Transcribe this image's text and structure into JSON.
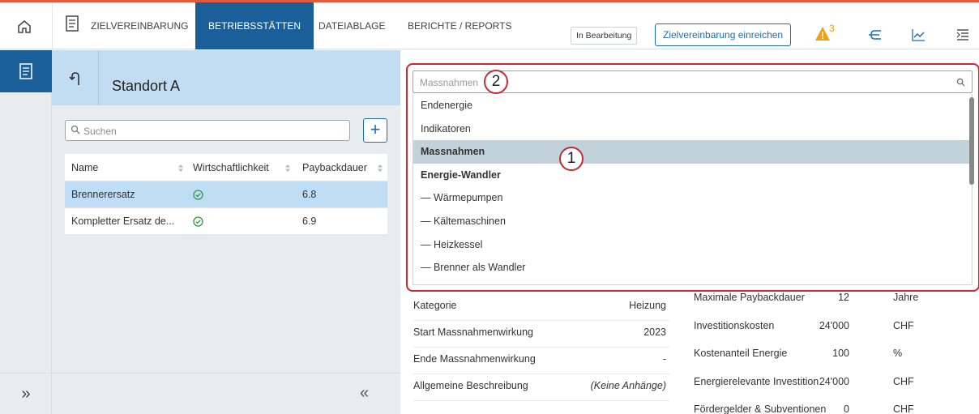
{
  "nav": {
    "tabs": [
      {
        "label": "ZIELVEREINBARUNG"
      },
      {
        "label": "BETRIEBSSTÄTTEN"
      },
      {
        "label": "DATEIABLAGE"
      },
      {
        "label": "BERICHTE / REPORTS"
      }
    ],
    "status_badge": "In Bearbeitung",
    "submit_label": "Zielvereinbarung einreichen",
    "warning_count": "3"
  },
  "location": {
    "title": "Standort A",
    "search_placeholder": "Suchen",
    "add_label": "+",
    "columns": [
      "Name",
      "Wirtschaftlichkeit",
      "Paybackdauer"
    ],
    "rows": [
      {
        "name": "Brennerersatz",
        "payback": "6.8",
        "selected": true
      },
      {
        "name": "Kompletter Ersatz de...",
        "payback": "6.9",
        "selected": false
      }
    ],
    "collapse_label": "«",
    "rail_expand_label": "»"
  },
  "details": {
    "rows": [
      {
        "label": "Kategorie",
        "value": "Heizung"
      },
      {
        "label": "Start Massnahmenwirkung",
        "value": "2023"
      },
      {
        "label": "Ende Massnahmenwirkung",
        "value": "-"
      },
      {
        "label": "Allgemeine Beschreibung",
        "value": "(Keine Anhänge)"
      }
    ],
    "kpis": [
      {
        "label": "Maximale Paybackdauer",
        "value": "12",
        "unit": "Jahre"
      },
      {
        "label": "Investitionskosten",
        "value": "24'000",
        "unit": "CHF"
      },
      {
        "label": "Kostenanteil Energie",
        "value": "100",
        "unit": "%"
      },
      {
        "label": "Energierelevante Investition",
        "value": "24'000",
        "unit": "CHF"
      },
      {
        "label": "Fördergelder & Subventionen",
        "value": "0",
        "unit": "CHF"
      }
    ]
  },
  "dropdown": {
    "placeholder": "Massnahmen",
    "items": [
      {
        "label": "Endenergie",
        "bold": false,
        "highlighted": false
      },
      {
        "label": "Indikatoren",
        "bold": false,
        "highlighted": false
      },
      {
        "label": "Massnahmen",
        "bold": true,
        "highlighted": true
      },
      {
        "label": "Energie-Wandler",
        "bold": true,
        "highlighted": false
      },
      {
        "label": "— Wärmepumpen",
        "bold": false,
        "highlighted": false
      },
      {
        "label": "— Kältemaschinen",
        "bold": false,
        "highlighted": false
      },
      {
        "label": "— Heizkessel",
        "bold": false,
        "highlighted": false
      },
      {
        "label": "— Brenner als Wandler",
        "bold": false,
        "highlighted": false
      }
    ]
  },
  "annotations": {
    "marker_1": "1",
    "marker_2": "2"
  },
  "colors": {
    "accent": "#1a5f9a",
    "annotation_red": "#c72a35",
    "warning": "#f0a015",
    "success": "#2e9e3e"
  }
}
